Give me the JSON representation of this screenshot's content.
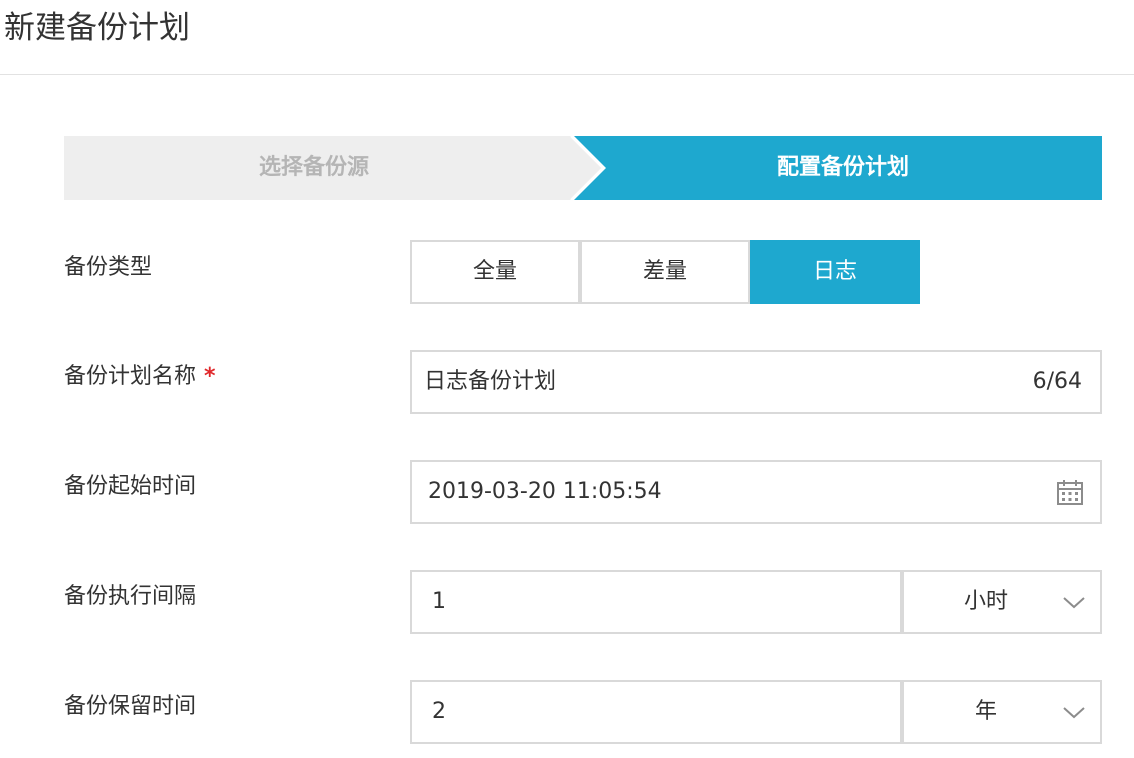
{
  "page": {
    "title": "新建备份计划"
  },
  "steps": [
    {
      "label": "选择备份源",
      "state": "done"
    },
    {
      "label": "配置备份计划",
      "state": "active"
    }
  ],
  "colors": {
    "accent": "#1ea8cf",
    "inactive_step": "#eeeeee",
    "required": "#e0282b",
    "border": "#d9d9d9"
  },
  "form": {
    "backup_type": {
      "label": "备份类型",
      "options": [
        "全量",
        "差量",
        "日志"
      ],
      "selected": "日志"
    },
    "plan_name": {
      "label": "备份计划名称",
      "required_mark": "*",
      "value": "日志备份计划",
      "counter": "6/64"
    },
    "start_time": {
      "label": "备份起始时间",
      "value": "2019-03-20 11:05:54",
      "icon": "calendar-icon"
    },
    "interval": {
      "label": "备份执行间隔",
      "value": "1",
      "unit": "小时",
      "icon": "chevron-down-icon"
    },
    "retention": {
      "label": "备份保留时间",
      "value": "2",
      "unit": "年",
      "icon": "chevron-down-icon"
    }
  }
}
